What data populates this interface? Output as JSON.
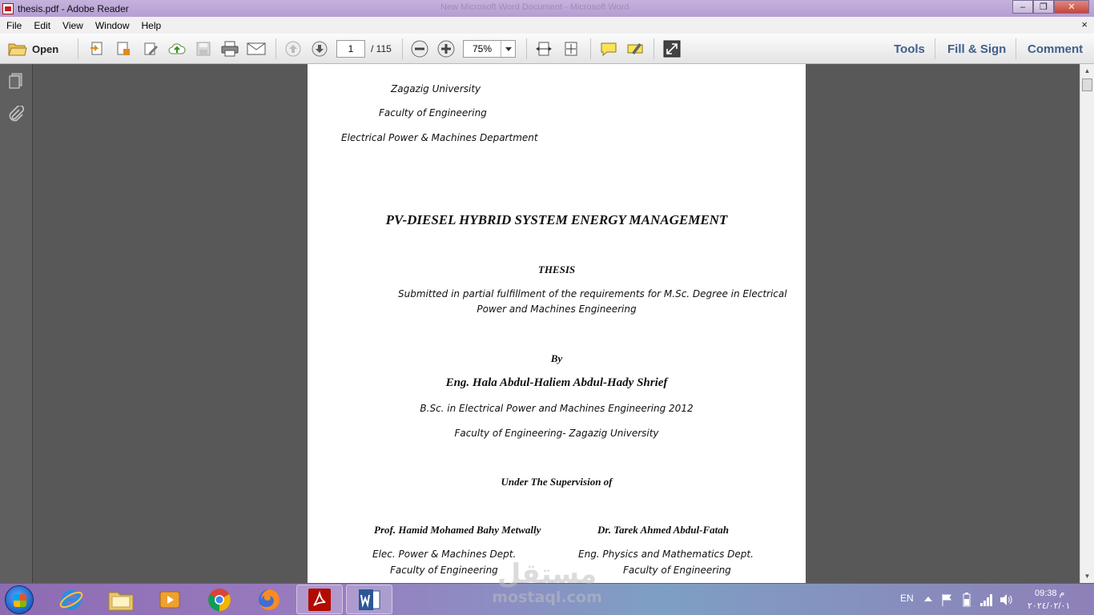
{
  "window": {
    "title": "thesis.pdf - Adobe Reader",
    "background_title": "New Microsoft Word Document - Microsoft Word",
    "controls": {
      "minimize": "–",
      "restore": "❐",
      "close": "✕"
    }
  },
  "menubar": {
    "items": [
      "File",
      "Edit",
      "View",
      "Window",
      "Help"
    ],
    "close_doc": "×"
  },
  "toolbar": {
    "open_label": "Open",
    "page_current": "1",
    "page_total": "/ 115",
    "zoom": "75%",
    "tools_label": "Tools",
    "fill_sign_label": "Fill & Sign",
    "comment_label": "Comment"
  },
  "document": {
    "header_lines": [
      "Zagazig University",
      "Faculty of Engineering",
      "Electrical Power & Machines Department"
    ],
    "title": "PV-DIESEL HYBRID SYSTEM ENERGY MANAGEMENT",
    "thesis_label": "THESIS",
    "submitted_line1": "Submitted in partial fulfillment of the requirements for M.Sc. Degree in Electrical",
    "submitted_line2": "Power and Machines Engineering",
    "by": "By",
    "author": "Eng. Hala Abdul-Haliem Abdul-Hady Shrief",
    "degree": "B.Sc. in Electrical Power and Machines Engineering 2012",
    "author_faculty": "Faculty of Engineering- Zagazig University",
    "supervision": "Under The Supervision of",
    "supervisors": [
      {
        "name": "Prof. Hamid Mohamed Bahy Metwally",
        "dept": "Elec. Power & Machines Dept.",
        "faculty": "Faculty of Engineering"
      },
      {
        "name": "Dr. Tarek Ahmed Abdul-Fatah",
        "dept": "Eng. Physics and Mathematics Dept.",
        "faculty": "Faculty of Engineering"
      }
    ]
  },
  "taskbar": {
    "language": "EN",
    "time": "09:38 م",
    "date": "٢٠٢٤/٠٢/٠١",
    "watermark_arabic": "مستقل",
    "watermark_latin": "mostaql.com"
  },
  "colors": {
    "title_bar": "#b49ed2",
    "doc_background": "#585858",
    "link_blue": "#3e5f8a"
  }
}
